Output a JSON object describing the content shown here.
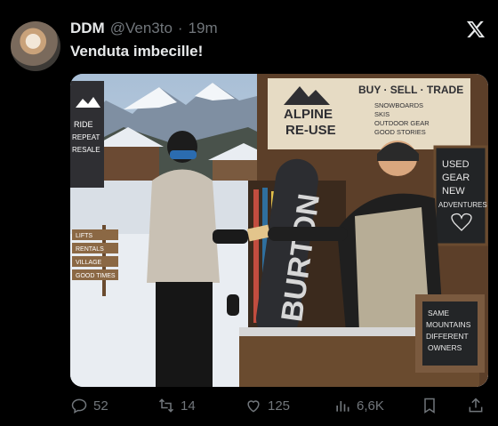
{
  "tweet": {
    "author_name": "DDM",
    "author_handle": "@Ven3to",
    "separator": "·",
    "time": "19m",
    "text": "Venduta imbecille!"
  },
  "icons": {
    "avatar": "avatar-image",
    "x_logo": "x-logo-icon",
    "reply": "reply-icon",
    "retweet": "retweet-icon",
    "like": "heart-icon",
    "views": "bar-chart-icon",
    "bookmark": "bookmark-icon",
    "share": "share-icon"
  },
  "actions": {
    "reply_count": "52",
    "retweet_count": "14",
    "like_count": "125",
    "view_count": "6,6K"
  },
  "image_text": {
    "banner_left": [
      "RIDE",
      "REPEAT",
      "RESALE"
    ],
    "shop_sign": {
      "logo_line1": "ALPINE",
      "logo_line2": "RE-USE",
      "headline": "BUY · SELL · TRADE",
      "items": [
        "SNOWBOARDS",
        "SKIS",
        "OUTDOOR GEAR",
        "GOOD STORIES"
      ]
    },
    "chalkboard_top": [
      "USED",
      "GEAR",
      "NEW",
      "ADVENTURES"
    ],
    "chalkboard_bottom": [
      "SAME",
      "MOUNTAINS",
      "DIFFERENT",
      "OWNERS"
    ],
    "signpost": [
      "LIFTS",
      "RENTALS",
      "VILLAGE",
      "GOOD TIMES"
    ],
    "snowboard_text": "BURTON"
  },
  "colors": {
    "background": "#000000",
    "text_primary": "#e7e9ea",
    "text_secondary": "#71767b"
  }
}
